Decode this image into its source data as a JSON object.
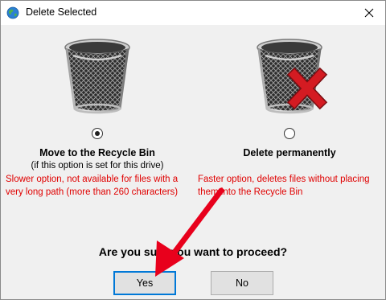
{
  "window": {
    "title": "Delete Selected",
    "app_icon": "globe-icon",
    "close_icon": "close-icon"
  },
  "options": [
    {
      "icon": "recycle-bin-icon",
      "selected": true,
      "title": "Move to the Recycle Bin",
      "subtitle": "(if this option is set for this drive)",
      "description_line1": "Slower option, not available for files with a",
      "description_line2": "very long path (more than 260 characters)"
    },
    {
      "icon": "delete-permanently-icon",
      "selected": false,
      "title": "Delete permanently",
      "description_line1": "Faster option, deletes files without placing",
      "description_line2": "them into the Recycle Bin"
    }
  ],
  "question": "Are you sure you want to proceed?",
  "buttons": {
    "yes_label": "Yes",
    "no_label": "No"
  },
  "colors": {
    "warning_text": "#e00000",
    "arrow": "#e8001c",
    "delete_mark": "#d41b22"
  },
  "overlay": {
    "icon": "red-arrow-annotation"
  }
}
